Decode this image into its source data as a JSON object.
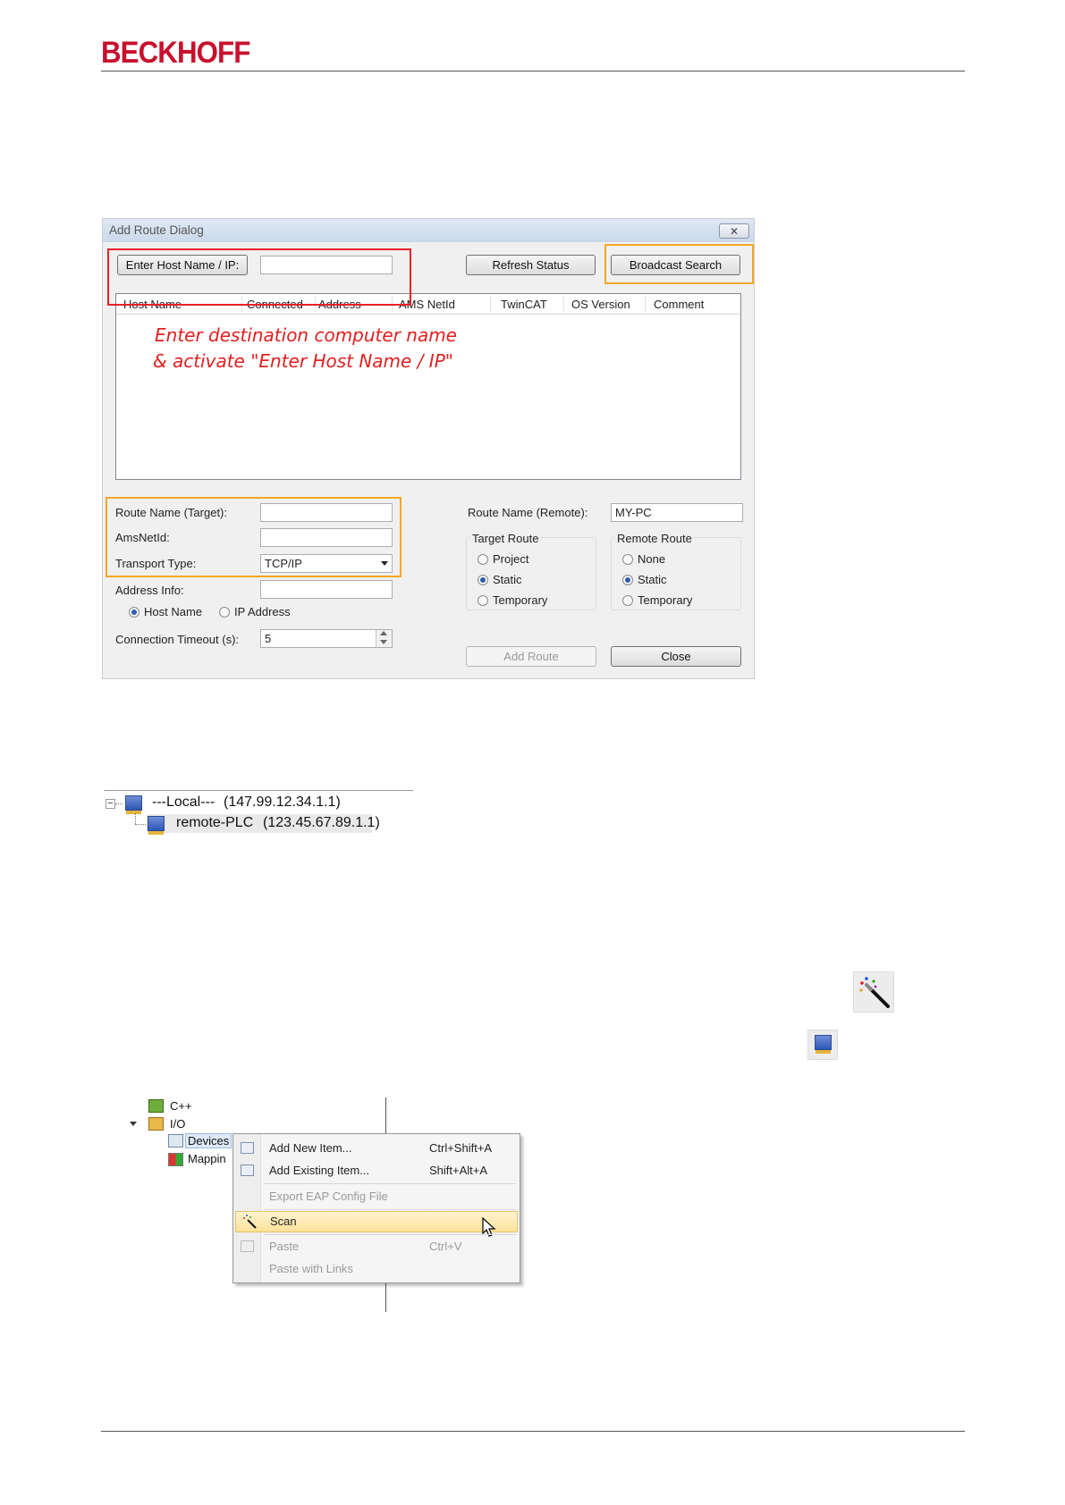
{
  "header": {
    "logo_text": "BECKHOFF"
  },
  "dialog": {
    "title": "Add Route Dialog",
    "close_glyph": "✕",
    "enter_host_button": "Enter Host Name / IP:",
    "host_input_value": "",
    "refresh_status_button": "Refresh Status",
    "broadcast_search_button": "Broadcast Search",
    "columns": [
      "Host Name",
      "Connected",
      "Address",
      "AMS NetId",
      "TwinCAT",
      "OS Version",
      "Comment"
    ],
    "note_line1": "Enter destination computer name",
    "note_line2": "& activate \"Enter Host Name / IP\"",
    "route_name_target_label": "Route Name (Target):",
    "route_name_target_value": "",
    "amsnetid_label": "AmsNetId:",
    "amsnetid_value": "",
    "transport_type_label": "Transport Type:",
    "transport_type_value": "TCP/IP",
    "address_info_label": "Address Info:",
    "address_info_value": "",
    "host_name_radio": "Host Name",
    "ip_address_radio": "IP Address",
    "connection_timeout_label": "Connection Timeout (s):",
    "connection_timeout_value": "5",
    "route_name_remote_label": "Route Name (Remote):",
    "route_name_remote_value": "MY-PC",
    "target_route_label": "Target Route",
    "target_route_options": [
      "Project",
      "Static",
      "Temporary"
    ],
    "target_route_selected": "Static",
    "remote_route_label": "Remote Route",
    "remote_route_options": [
      "None",
      "Static",
      "Temporary"
    ],
    "remote_route_selected": "Static",
    "add_route_button": "Add Route",
    "close_button": "Close"
  },
  "route_tree": {
    "expander": "−",
    "local_name": "---Local---",
    "local_address": "(147.99.12.34.1.1)",
    "remote_name": "remote-PLC",
    "remote_address": "(123.45.67.89.1.1)"
  },
  "io_tree": {
    "cpp_label": "C++",
    "io_label": "I/O",
    "devices_label": "Devices",
    "mappings_label": "Mappin"
  },
  "context_menu": {
    "items": [
      {
        "label": "Add New Item...",
        "shortcut": "Ctrl+Shift+A"
      },
      {
        "label": "Add Existing Item...",
        "shortcut": "Shift+Alt+A"
      },
      {
        "label": "Export EAP Config File",
        "shortcut": ""
      },
      {
        "label": "Scan",
        "shortcut": ""
      },
      {
        "label": "Paste",
        "shortcut": "Ctrl+V"
      },
      {
        "label": "Paste with Links",
        "shortcut": ""
      }
    ]
  },
  "colors": {
    "brand_red": "#c8102e",
    "highlight_red": "#e8202a",
    "highlight_orange": "#f5a623",
    "note_red": "#e02020"
  }
}
